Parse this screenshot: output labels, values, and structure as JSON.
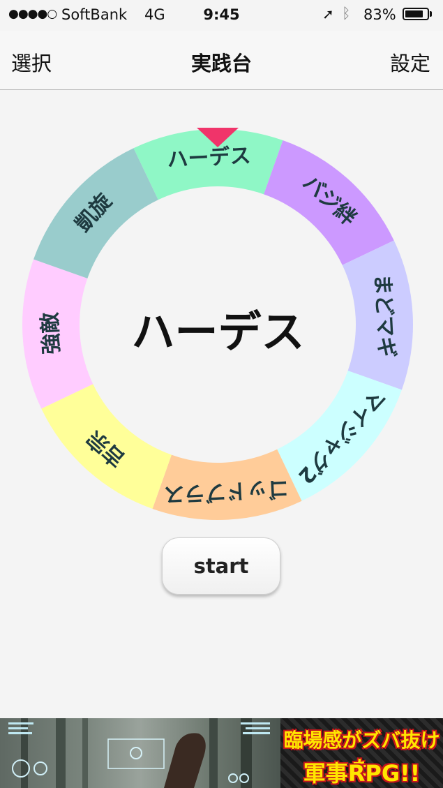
{
  "status_bar": {
    "signal": "●●●●○",
    "carrier": "SoftBank",
    "network": "4G",
    "time": "9:45",
    "location_icon": "location-arrow-icon",
    "bluetooth_icon": "bluetooth-icon",
    "battery_percent": "83%",
    "battery_level": 0.83
  },
  "nav": {
    "left_label": "選択",
    "title": "実践台",
    "right_label": "設定"
  },
  "roulette": {
    "pointer_color": "#f0346a",
    "result": "ハーデス",
    "segments": [
      {
        "label": "ハーデス",
        "color": "#8ff7c6"
      },
      {
        "label": "バジ絆",
        "color": "#cc99ff"
      },
      {
        "label": "まどマギ",
        "color": "#ccccff"
      },
      {
        "label": "マイジャグ2",
        "color": "#ccffff"
      },
      {
        "label": "ゴッドブラス",
        "color": "#ffcc99"
      },
      {
        "label": "吉宗",
        "color": "#ffff99"
      },
      {
        "label": "強敵",
        "color": "#ffccff"
      },
      {
        "label": "凱旋",
        "color": "#99cccc"
      }
    ]
  },
  "start_button": {
    "label": "start"
  },
  "ad": {
    "line1": "臨場感がズバ抜けた",
    "line2": "軍事RPG!!"
  }
}
